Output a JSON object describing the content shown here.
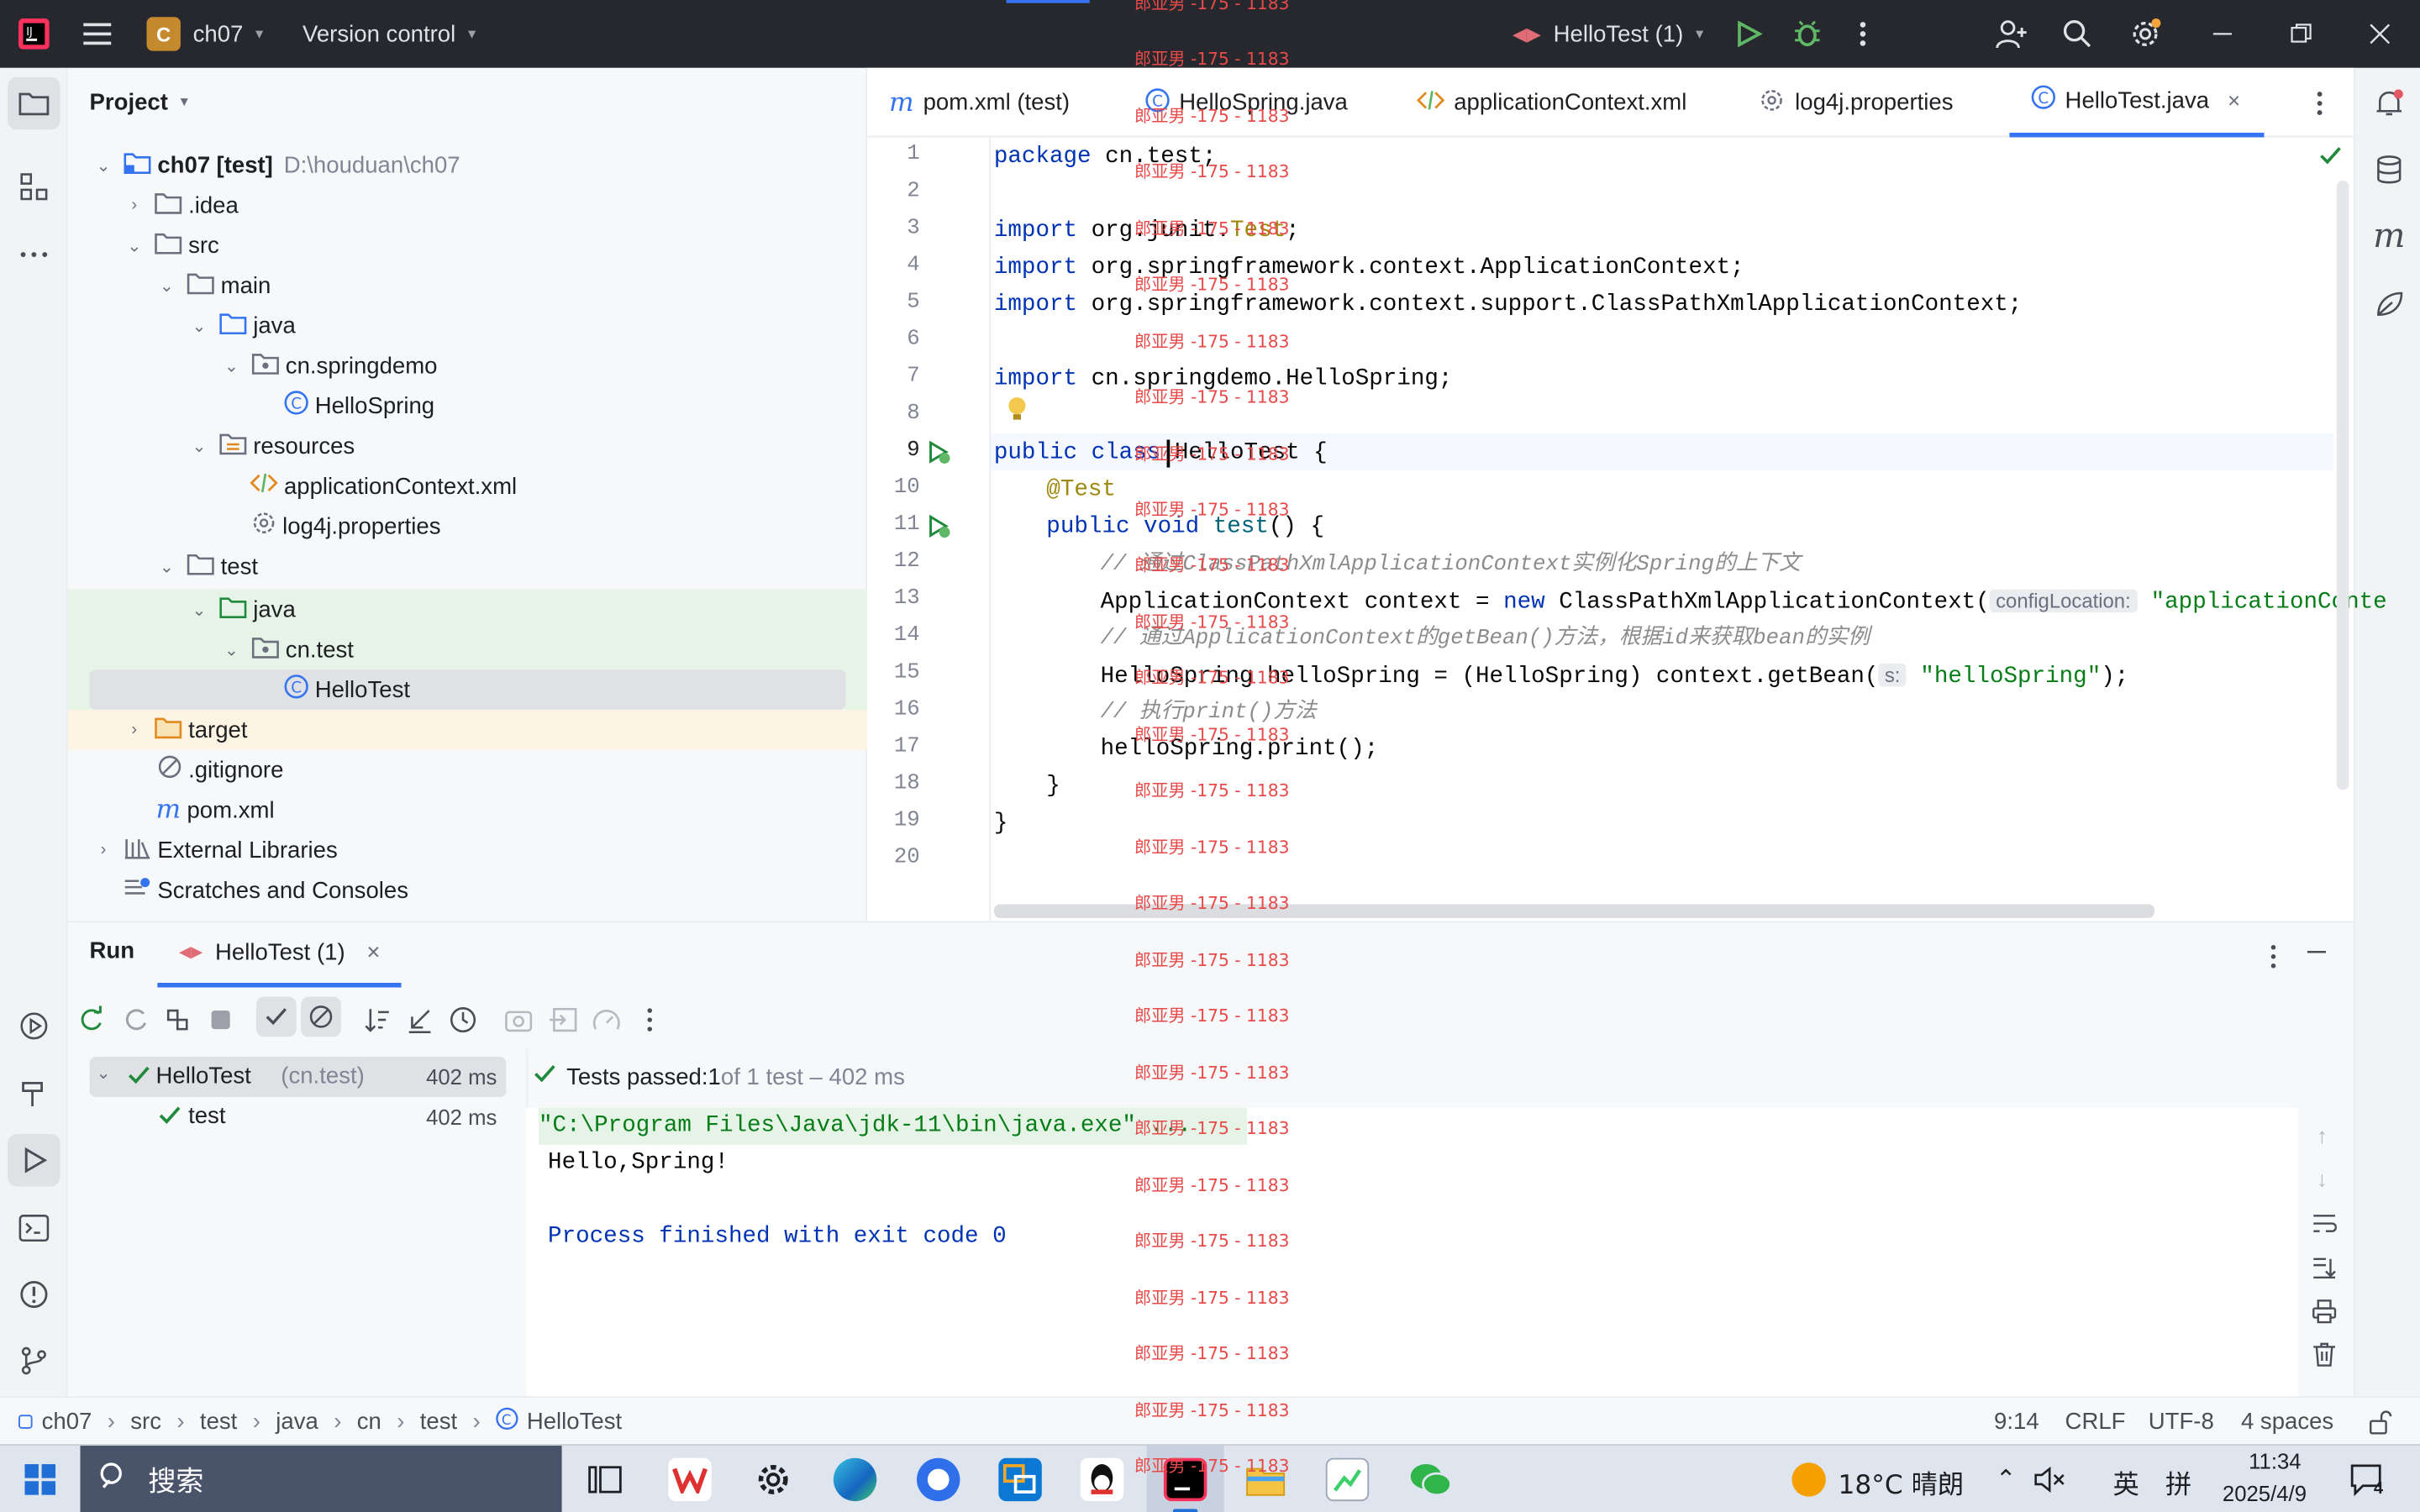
{
  "titlebar": {
    "project_badge": "C",
    "project_name": "ch07",
    "vcs_label": "Version control",
    "run_config": "HelloTest (1)"
  },
  "project_panel": {
    "title": "Project",
    "tree": [
      {
        "label": "ch07",
        "suffix": "[test]",
        "path": "D:\\houduan\\ch07"
      },
      {
        "label": ".idea"
      },
      {
        "label": "src"
      },
      {
        "label": "main"
      },
      {
        "label": "java"
      },
      {
        "label": "cn.springdemo"
      },
      {
        "label": "HelloSpring"
      },
      {
        "label": "resources"
      },
      {
        "label": "applicationContext.xml"
      },
      {
        "label": "log4j.properties"
      },
      {
        "label": "test"
      },
      {
        "label": "java"
      },
      {
        "label": "cn.test"
      },
      {
        "label": "HelloTest"
      },
      {
        "label": "target"
      },
      {
        "label": ".gitignore"
      },
      {
        "label": "pom.xml"
      },
      {
        "label": "External Libraries"
      },
      {
        "label": "Scratches and Consoles"
      }
    ]
  },
  "editor": {
    "tabs": [
      "pom.xml (test)",
      "HelloSpring.java",
      "applicationContext.xml",
      "log4j.properties",
      "HelloTest.java"
    ],
    "active_tab": "HelloTest.java",
    "line_numbers": [
      "1",
      "2",
      "3",
      "4",
      "5",
      "6",
      "7",
      "8",
      "9",
      "10",
      "11",
      "12",
      "13",
      "14",
      "15",
      "16",
      "17",
      "18",
      "19",
      "20"
    ],
    "code": {
      "l1_kw": "package",
      "l1_rest": " cn.test;",
      "l3_kw": "import",
      "l3_a": " org.junit.",
      "l3_b": "Test",
      "l3_c": ";",
      "l4_kw": "import",
      "l4_rest": " org.springframework.context.ApplicationContext;",
      "l5_kw": "import",
      "l5_rest": " org.springframework.context.support.ClassPathXmlApplicationContext;",
      "l7_kw": "import",
      "l7_rest": " cn.springdemo.HelloSpring;",
      "l9_kw": "public class",
      "l9_rest": " HelloTest {",
      "l10_an": "@Test",
      "l11_kw": "public void",
      "l11_fn": " test",
      "l11_rest": "() {",
      "l12_cm": "// 通过ClassPathXmlApplicationContext实例化Spring的上下文",
      "l13_a": "ApplicationContext context = ",
      "l13_kw": "new",
      "l13_b": " ClassPathXmlApplicationContext(",
      "l13_hint": "configLocation:",
      "l13_st": " \"applicationConte",
      "l14_cm": "// 通过ApplicationContext的getBean()方法，根据id来获取bean的实例",
      "l15_a": "HelloSpring helloSpring = (HelloSpring) context.getBean(",
      "l15_hint": "s:",
      "l15_st": " \"helloSpring\"",
      "l15_c": ");",
      "l16_cm": "// 执行print()方法",
      "l17": "helloSpring.print();",
      "l18": "}",
      "l19": "}"
    }
  },
  "run_panel": {
    "title": "Run",
    "tab": "HelloTest (1)",
    "tests": [
      {
        "name": "HelloTest",
        "pkg": "(cn.test)",
        "time": "402 ms"
      },
      {
        "name": "test",
        "time": "402 ms"
      }
    ],
    "summary_prefix": "Tests passed: ",
    "summary_count": "1",
    "summary_rest": " of 1 test – 402 ms",
    "console": [
      "\"C:\\Program Files\\Java\\jdk-11\\bin\\java.exe\" ...",
      "Hello,Spring!",
      "",
      "Process finished with exit code 0"
    ]
  },
  "status_bar": {
    "breadcrumb": [
      "ch07",
      "src",
      "test",
      "java",
      "cn",
      "test",
      "HelloTest"
    ],
    "position": "9:14",
    "line_sep": "CRLF",
    "encoding": "UTF-8",
    "indent": "4 spaces"
  },
  "taskbar": {
    "search": "搜索",
    "weather": "18°C 晴朗",
    "ime_lang": "英",
    "ime_mode": "拼",
    "time": "11:34",
    "date": "2025/4/9",
    "notif_count": "4"
  },
  "watermark": "郎亚男 -175 - 1183",
  "colors": {
    "accent": "#3574f0",
    "success": "#208a3c",
    "titlebar": "#27282e"
  }
}
